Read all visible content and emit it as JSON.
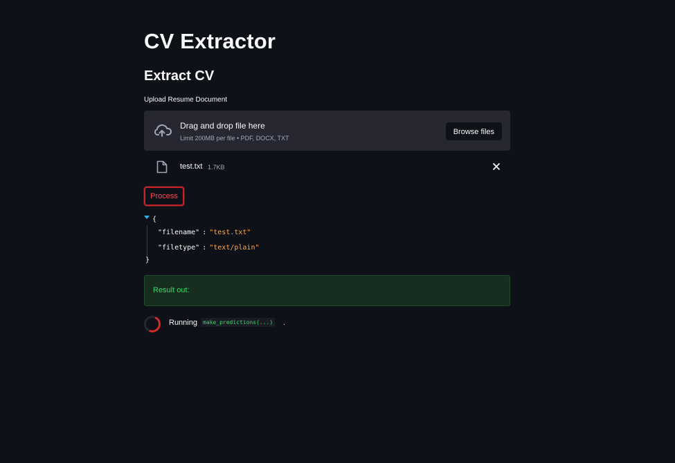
{
  "app": {
    "title": "CV Extractor",
    "subtitle": "Extract CV"
  },
  "uploader": {
    "label": "Upload Resume Document",
    "drop_text": "Drag and drop file here",
    "limit_text": "Limit 200MB per file • PDF, DOCX, TXT",
    "browse_label": "Browse files",
    "icon": "cloud-upload-icon"
  },
  "uploaded_file": {
    "name": "test.txt",
    "size": "1.7KB",
    "icon": "file-icon",
    "remove_icon": "close-icon"
  },
  "process_button": {
    "label": "Process"
  },
  "json_output": {
    "open_brace": "{",
    "close_brace": "}",
    "entries": [
      {
        "key": "\"filename\"",
        "colon": ":",
        "value": "\"test.txt\""
      },
      {
        "key": "\"filetype\"",
        "colon": ":",
        "value": "\"text/plain\""
      }
    ]
  },
  "result": {
    "text": "Result out:"
  },
  "status": {
    "label": "Running",
    "code": "make_predictions(...)",
    "suffix": "."
  },
  "colors": {
    "background": "#0e1117",
    "panel": "#262730",
    "accent_red": "#ff4b4b",
    "success_green": "#3dd56d",
    "json_string": "#ffa94d",
    "json_toggle": "#29b5e8"
  }
}
